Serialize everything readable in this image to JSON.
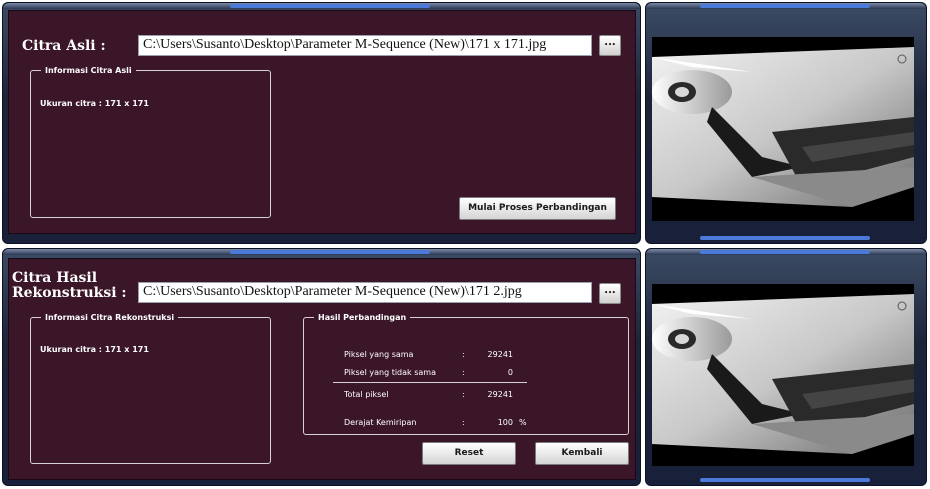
{
  "top": {
    "label": "Citra Asli  :",
    "path_value": "C:\\Users\\Susanto\\Desktop\\Parameter M-Sequence (New)\\171 x 171.jpg",
    "browse_label": "...",
    "info_group": {
      "legend": "Informasi Citra Asli",
      "size_text": "Ukuran citra :  171 x 171"
    },
    "compare_button": "Mulai Proses Perbandingan"
  },
  "bottom": {
    "label_line1": "Citra Hasil",
    "label_line2": "Rekonstruksi  :",
    "path_value": "C:\\Users\\Susanto\\Desktop\\Parameter M-Sequence (New)\\171 2.jpg",
    "browse_label": "...",
    "info_group": {
      "legend": "Informasi Citra Rekonstruksi",
      "size_text": "Ukuran citra :  171 x 171"
    },
    "result_group": {
      "legend": "Hasil Perbandingan",
      "rows": [
        {
          "label": "Piksel yang sama",
          "sep": ":",
          "value": "29241",
          "unit": ""
        },
        {
          "label": "Piksel yang tidak sama",
          "sep": ":",
          "value": "0",
          "unit": ""
        },
        {
          "label": "Total piksel",
          "sep": ":",
          "value": "29241",
          "unit": ""
        },
        {
          "label": "Derajat Kemiripan",
          "sep": ":",
          "value": "100",
          "unit": "%"
        }
      ]
    },
    "reset_button": "Reset",
    "back_button": "Kembali"
  },
  "colors": {
    "panel_bg": "#3a1628",
    "frame": "#1c2438",
    "accent": "#4c7ad8"
  }
}
